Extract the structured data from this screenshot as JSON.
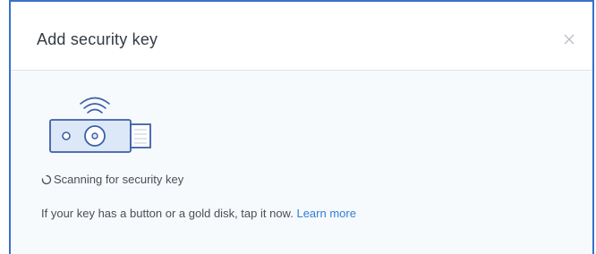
{
  "dialog": {
    "title": "Add security key",
    "close_icon": "close-icon"
  },
  "status": {
    "icon": "spinner-icon",
    "text": "Scanning for security key"
  },
  "instructions": {
    "text": "If your key has a button or a gold disk, tap it now.",
    "link_label": "Learn more"
  },
  "colors": {
    "accent": "#3a70c9",
    "link": "#2f7fd3",
    "illustration_stroke": "#3d5ea8",
    "illustration_fill": "#dce8f8"
  }
}
